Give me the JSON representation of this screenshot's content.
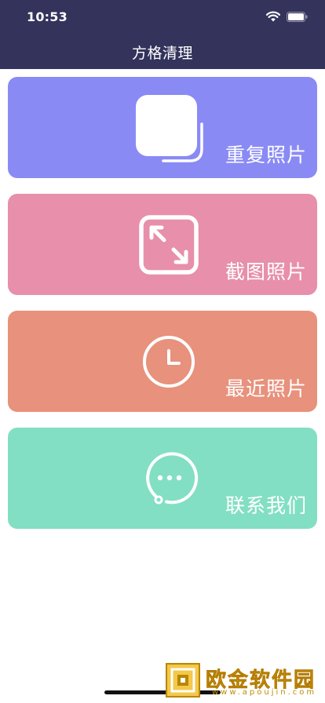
{
  "status_bar": {
    "time": "10:53",
    "icons": [
      "wifi-icon",
      "battery-icon"
    ]
  },
  "header": {
    "title": "方格清理"
  },
  "cards": [
    {
      "label": "重复照片",
      "icon": "duplicate-photos-icon",
      "color": "#8a8af5"
    },
    {
      "label": "截图照片",
      "icon": "expand-arrows-icon",
      "color": "#e78fab"
    },
    {
      "label": "最近照片",
      "icon": "clock-icon",
      "color": "#e8917c"
    },
    {
      "label": "联系我们",
      "icon": "chat-bubble-icon",
      "color": "#82dfc3"
    }
  ],
  "watermark": {
    "title": "欧金软件园",
    "url": "www.apoujin.com",
    "color": "#e0a000"
  },
  "colors": {
    "header_background": "#33335c",
    "page_background": "#ffffff"
  }
}
